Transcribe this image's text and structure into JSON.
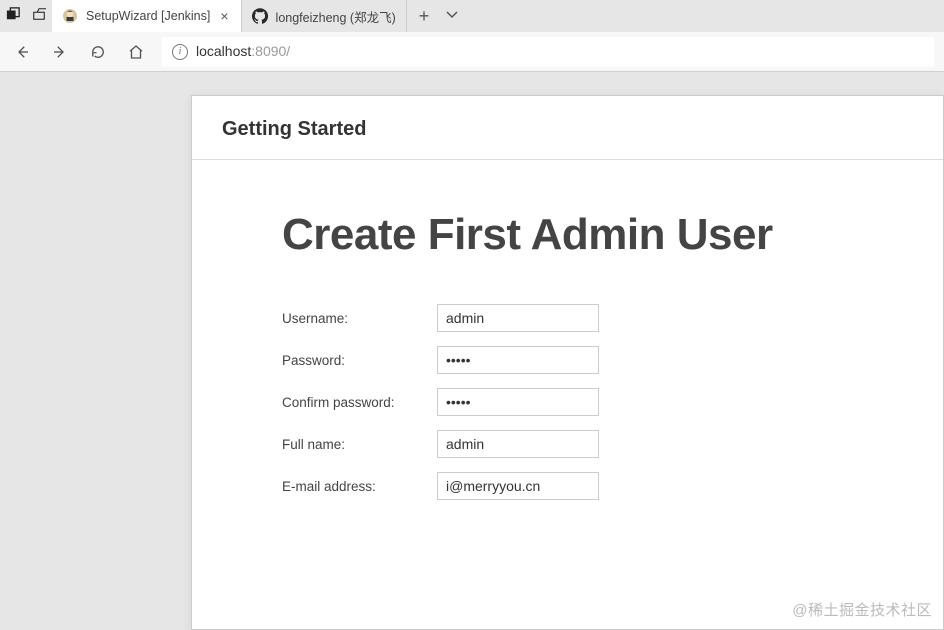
{
  "tabs": [
    {
      "title": "SetupWizard [Jenkins]"
    },
    {
      "title": "longfeizheng (郑龙飞)"
    }
  ],
  "url": {
    "host": "localhost",
    "port": ":8090/"
  },
  "panel": {
    "header": "Getting Started",
    "title": "Create First Admin User"
  },
  "form": {
    "username": {
      "label": "Username:",
      "value": "admin"
    },
    "password": {
      "label": "Password:",
      "value": "•••••"
    },
    "confirm": {
      "label": "Confirm password:",
      "value": "•••••"
    },
    "fullname": {
      "label": "Full name:",
      "value": "admin"
    },
    "email": {
      "label": "E-mail address:",
      "value": "i@merryyou.cn"
    }
  },
  "watermark": "@稀土掘金技术社区"
}
